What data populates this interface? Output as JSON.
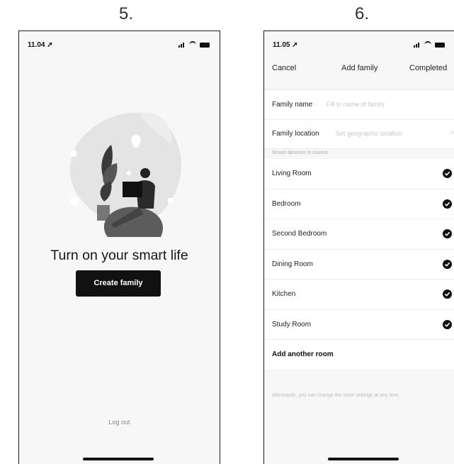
{
  "steps": {
    "left": "5.",
    "right": "6."
  },
  "screen_a": {
    "time": "11.04",
    "headline": "Turn on your smart life",
    "create_button": "Create family",
    "logout": "Log out"
  },
  "screen_b": {
    "time": "11.05",
    "nav": {
      "cancel": "Cancel",
      "title": "Add family",
      "done": "Completed"
    },
    "form": {
      "name_label": "Family name",
      "name_placeholder": "Fill in name of family",
      "location_label": "Family location",
      "location_placeholder": "Set geographic location",
      "chevron": ">"
    },
    "rooms_header": "Smart devices in rooms:",
    "rooms": [
      {
        "label": "Living Room",
        "checked": true
      },
      {
        "label": "Bedroom",
        "checked": true
      },
      {
        "label": "Second Bedroom",
        "checked": true
      },
      {
        "label": "Dining Room",
        "checked": true
      },
      {
        "label": "Kitchen",
        "checked": true
      },
      {
        "label": "Study Room",
        "checked": true
      }
    ],
    "add_room": "Add another room",
    "footnote": "Afterwards, you can change the room settings at any time."
  },
  "colors": {
    "button_bg": "#111111",
    "screen_bg": "#f7f7f7"
  },
  "icons": [
    "location-arrow-icon",
    "signal-icon",
    "wifi-icon",
    "battery-icon",
    "check-circle-icon"
  ]
}
